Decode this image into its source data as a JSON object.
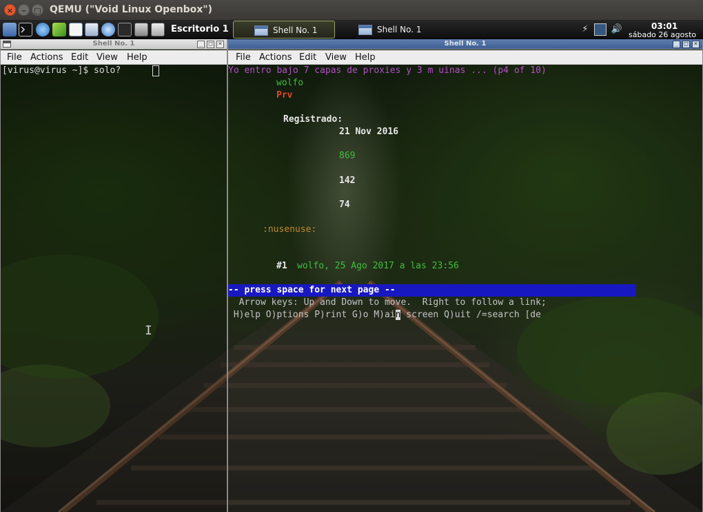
{
  "host": {
    "title": "QEMU (\"Void Linux Openbox\")",
    "close_glyph": "×",
    "min_glyph": "–",
    "max_glyph": "□"
  },
  "panel": {
    "launchers": [
      "file-manager-icon",
      "terminal-icon",
      "network-icon",
      "leaf-icon",
      "text-editor-icon",
      "document-viewer-icon",
      "web-browser-icon",
      "mail-icon",
      "display-icon",
      "printer-icon"
    ],
    "desktop_label": "Escritorio 1",
    "tasks": [
      {
        "label": "Shell No. 1"
      },
      {
        "label": "Shell No. 1"
      }
    ],
    "clock": {
      "time": "03:01",
      "date": "sábado 26 agosto"
    }
  },
  "left_terminal": {
    "title": "Shell No. 1",
    "menu": [
      "File",
      "Actions",
      "Edit",
      "View",
      "Help"
    ],
    "prompt": "[virus@virus ~]$ solo?"
  },
  "right_terminal": {
    "title": "Shell No. 1",
    "menu": [
      "File",
      "Actions",
      "Edit",
      "View",
      "Help"
    ],
    "lines": {
      "title_line": "Yo entro bajo 7 capas de proxies y 3 m uinas ... (p4 of 10)",
      "user": "wolfo",
      "rank": "Prv",
      "registered_label": "Registrado:",
      "registered_date": "21 Nov 2016",
      "num1": "869",
      "num2": "142",
      "num3": "74",
      "signature": ":nusenuse:",
      "post_num": "#1",
      "post_meta": "wolfo, 25 Ago 2017 a las 23:56",
      "pager": "-- press space for next page --",
      "help1": "  Arrow keys: Up and Down to move.  Right to follow a link;",
      "help2_pre": " H)elp O)ptions P)rint G)o M)ai",
      "help2_cursor": "n",
      "help2_post": " screen Q)uit /=search [de"
    }
  },
  "colors": {
    "pager_bg": "#1818c0",
    "magenta": "#b24fc6",
    "green": "#3fbf3f",
    "red": "#e0462f",
    "orange": "#c0892a"
  }
}
